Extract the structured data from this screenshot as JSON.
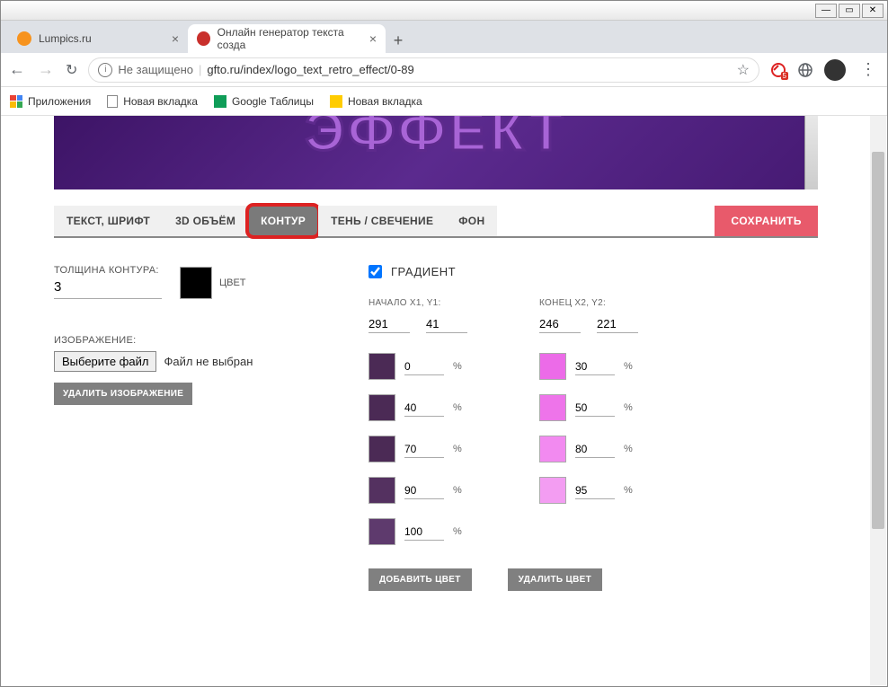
{
  "window": {
    "min": "—",
    "max": "▭",
    "close": "✕"
  },
  "browser": {
    "tabs": [
      {
        "title": "Lumpics.ru",
        "favicon_color": "#f7931e",
        "active": false
      },
      {
        "title": "Онлайн генератор текста созда",
        "favicon_color": "#c9302c",
        "active": true
      }
    ],
    "new_tab": "+",
    "nav": {
      "back": "←",
      "forward": "→",
      "reload": "↻"
    },
    "security_text": "Не защищено",
    "url": "gfto.ru/index/logo_text_retro_effect/0-89",
    "ext_badge": "5",
    "bookmarks": [
      {
        "label": "Приложения",
        "kind": "apps"
      },
      {
        "label": "Новая вкладка",
        "kind": "doc"
      },
      {
        "label": "Google Таблицы",
        "kind": "sheets"
      },
      {
        "label": "Новая вкладка",
        "kind": "yandex"
      }
    ]
  },
  "preview": {
    "text": "ЭФФЕКТ"
  },
  "editor_tabs": [
    {
      "label": "ТЕКСТ, ШРИФТ"
    },
    {
      "label": "3D ОБЪЁМ"
    },
    {
      "label": "КОНТУР",
      "active": true
    },
    {
      "label": "ТЕНЬ / СВЕЧЕНИЕ"
    },
    {
      "label": "ФОН"
    }
  ],
  "save_label": "СОХРАНИТЬ",
  "outline": {
    "thickness_label": "ТОЛЩИНА КОНТУРА:",
    "thickness_value": "3",
    "color_label": "ЦВЕТ",
    "color_value": "#000000",
    "image_label": "ИЗОБРАЖЕНИЕ:",
    "file_button": "Выберите файл",
    "file_status": "Файл не выбран",
    "delete_image": "УДАЛИТЬ ИЗОБРАЖЕНИЕ"
  },
  "gradient": {
    "label": "ГРАДИЕНТ",
    "checked": true,
    "start_label": "НАЧАЛО X1, Y1:",
    "end_label": "КОНЕЦ X2, Y2:",
    "x1": "291",
    "y1": "41",
    "x2": "246",
    "y2": "221",
    "left_stops": [
      {
        "color": "#4b2a55",
        "pct": "0"
      },
      {
        "color": "#4b2a55",
        "pct": "40"
      },
      {
        "color": "#4b2a55",
        "pct": "70"
      },
      {
        "color": "#543160",
        "pct": "90"
      },
      {
        "color": "#5e3a6d",
        "pct": "100"
      }
    ],
    "right_stops": [
      {
        "color": "#ec6be8",
        "pct": "30"
      },
      {
        "color": "#ee74ea",
        "pct": "50"
      },
      {
        "color": "#f28af0",
        "pct": "80"
      },
      {
        "color": "#f39df2",
        "pct": "95"
      }
    ],
    "pct_symbol": "%",
    "add_color": "ДОБАВИТЬ ЦВЕТ",
    "del_color": "УДАЛИТЬ ЦВЕТ"
  }
}
